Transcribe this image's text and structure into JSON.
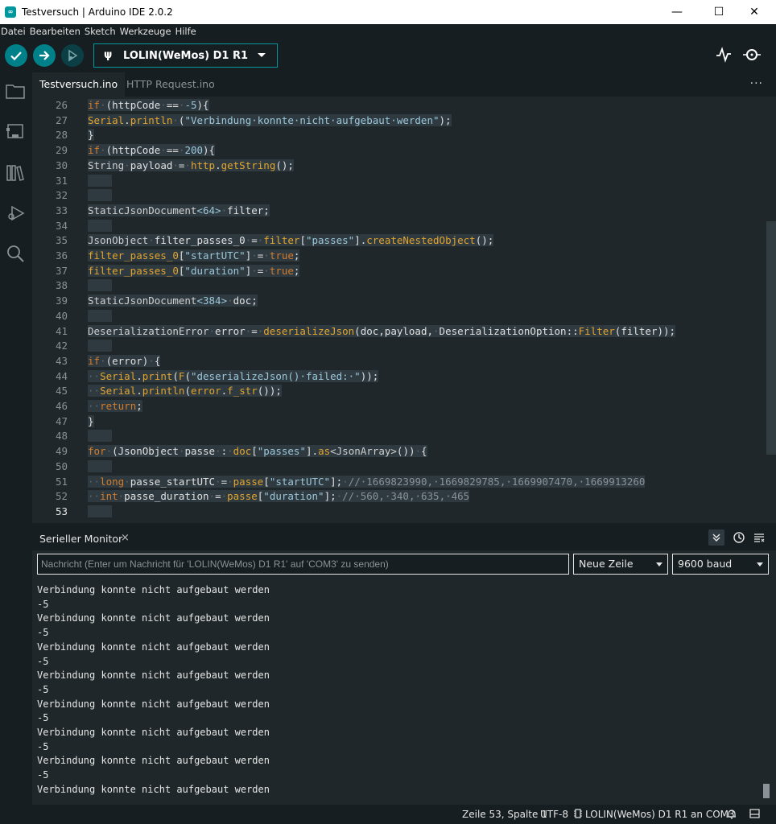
{
  "window": {
    "title": "Testversuch | Arduino IDE 2.0.2",
    "app_icon": "arduino-icon"
  },
  "menu": [
    "Datei",
    "Bearbeiten",
    "Sketch",
    "Werkzeuge",
    "Hilfe"
  ],
  "toolbar": {
    "verify_icon": "check-icon",
    "upload_icon": "arrow-right-icon",
    "debug_icon": "debug-icon",
    "board": "LOLIN(WeMos) D1 R1",
    "plotter_icon": "pulse-icon",
    "monitor_icon": "magnifier-icon"
  },
  "sidebar": [
    "folder-icon",
    "board-icon",
    "library-icon",
    "debug-icon",
    "search-icon"
  ],
  "tabs": [
    {
      "label": "Testversuch.ino",
      "active": true
    },
    {
      "label": "HTTP Request.ino",
      "active": false
    }
  ],
  "tabs_more": "···",
  "editor": {
    "current_line": 53,
    "lines": [
      {
        "n": "26",
        "segs": [
          [
            "kw",
            "if"
          ],
          [
            "ws",
            "·"
          ],
          [
            "",
            "(httpCode"
          ],
          [
            "ws",
            "·"
          ],
          [
            "",
            "=="
          ],
          [
            "ws",
            "·"
          ],
          [
            "num",
            "-5"
          ],
          [
            "",
            "){"
          ]
        ]
      },
      {
        "n": "27",
        "segs": [
          [
            "fn",
            "Serial"
          ],
          [
            "",
            "."
          ],
          [
            "fn",
            "println"
          ],
          [
            "ws",
            "·"
          ],
          [
            "",
            "("
          ],
          [
            "str",
            "\"Verbindung·konnte·nicht·aufgebaut·werden\""
          ],
          [
            "",
            ");"
          ]
        ]
      },
      {
        "n": "28",
        "segs": [
          [
            "",
            "}"
          ]
        ]
      },
      {
        "n": "29",
        "segs": [
          [
            "kw",
            "if"
          ],
          [
            "ws",
            "·"
          ],
          [
            "",
            "(httpCode"
          ],
          [
            "ws",
            "·"
          ],
          [
            "",
            "=="
          ],
          [
            "ws",
            "·"
          ],
          [
            "num",
            "200"
          ],
          [
            "",
            "){"
          ]
        ]
      },
      {
        "n": "30",
        "segs": [
          [
            "ty",
            "String"
          ],
          [
            "ws",
            "·"
          ],
          [
            "",
            "payload"
          ],
          [
            "ws",
            "·"
          ],
          [
            "",
            "="
          ],
          [
            "ws",
            "·"
          ],
          [
            "fn",
            "http"
          ],
          [
            "",
            "."
          ],
          [
            "fn",
            "getString"
          ],
          [
            "",
            "();"
          ]
        ]
      },
      {
        "n": "31",
        "segs": [
          [
            "",
            ""
          ]
        ]
      },
      {
        "n": "32",
        "segs": [
          [
            "",
            ""
          ]
        ]
      },
      {
        "n": "33",
        "segs": [
          [
            "ty",
            "StaticJsonDocument"
          ],
          [
            "num",
            "<64>"
          ],
          [
            "ws",
            "·"
          ],
          [
            "",
            "filter;"
          ]
        ]
      },
      {
        "n": "34",
        "segs": [
          [
            "",
            ""
          ]
        ]
      },
      {
        "n": "35",
        "segs": [
          [
            "ty",
            "JsonObject"
          ],
          [
            "ws",
            "·"
          ],
          [
            "",
            "filter_passes_0"
          ],
          [
            "ws",
            "·"
          ],
          [
            "",
            "="
          ],
          [
            "ws",
            "·"
          ],
          [
            "fn",
            "filter"
          ],
          [
            "",
            "["
          ],
          [
            "str",
            "\"passes\""
          ],
          [
            "",
            "]."
          ],
          [
            "fn",
            "createNestedObject"
          ],
          [
            "",
            "();"
          ]
        ]
      },
      {
        "n": "36",
        "segs": [
          [
            "fn",
            "filter_passes_0"
          ],
          [
            "",
            "["
          ],
          [
            "str",
            "\"startUTC\""
          ],
          [
            "",
            "]"
          ],
          [
            "ws",
            "·"
          ],
          [
            "",
            "="
          ],
          [
            "ws",
            "·"
          ],
          [
            "kw",
            "true"
          ],
          [
            "",
            ";"
          ]
        ]
      },
      {
        "n": "37",
        "segs": [
          [
            "fn",
            "filter_passes_0"
          ],
          [
            "",
            "["
          ],
          [
            "str",
            "\"duration\""
          ],
          [
            "",
            "]"
          ],
          [
            "ws",
            "·"
          ],
          [
            "",
            "="
          ],
          [
            "ws",
            "·"
          ],
          [
            "kw",
            "true"
          ],
          [
            "",
            ";"
          ]
        ]
      },
      {
        "n": "38",
        "segs": [
          [
            "",
            ""
          ]
        ]
      },
      {
        "n": "39",
        "segs": [
          [
            "ty",
            "StaticJsonDocument"
          ],
          [
            "num",
            "<384>"
          ],
          [
            "ws",
            "·"
          ],
          [
            "",
            "doc;"
          ]
        ]
      },
      {
        "n": "40",
        "segs": [
          [
            "",
            ""
          ]
        ]
      },
      {
        "n": "41",
        "segs": [
          [
            "ty",
            "DeserializationError"
          ],
          [
            "ws",
            "·"
          ],
          [
            "",
            "error"
          ],
          [
            "ws",
            "·"
          ],
          [
            "",
            "="
          ],
          [
            "ws",
            "·"
          ],
          [
            "fn",
            "deserializeJson"
          ],
          [
            "",
            "(doc,payload,"
          ],
          [
            "ws",
            "·"
          ],
          [
            "",
            "DeserializationOption::"
          ],
          [
            "fn",
            "Filter"
          ],
          [
            "",
            "(filter));"
          ]
        ]
      },
      {
        "n": "42",
        "segs": [
          [
            "",
            ""
          ]
        ]
      },
      {
        "n": "43",
        "segs": [
          [
            "kw",
            "if"
          ],
          [
            "ws",
            "·"
          ],
          [
            "",
            "(error)"
          ],
          [
            "ws",
            "·"
          ],
          [
            "",
            "{"
          ]
        ]
      },
      {
        "n": "44",
        "segs": [
          [
            "ws",
            "··"
          ],
          [
            "fn",
            "Serial"
          ],
          [
            "",
            "."
          ],
          [
            "fn",
            "print"
          ],
          [
            "",
            "("
          ],
          [
            "fn",
            "F"
          ],
          [
            "",
            "("
          ],
          [
            "str",
            "\"deserializeJson()·failed:·\""
          ],
          [
            "",
            "));"
          ]
        ]
      },
      {
        "n": "45",
        "segs": [
          [
            "ws",
            "··"
          ],
          [
            "fn",
            "Serial"
          ],
          [
            "",
            "."
          ],
          [
            "fn",
            "println"
          ],
          [
            "",
            "("
          ],
          [
            "fn",
            "error"
          ],
          [
            "",
            "."
          ],
          [
            "fn",
            "f_str"
          ],
          [
            "",
            "());"
          ]
        ]
      },
      {
        "n": "46",
        "segs": [
          [
            "ws",
            "··"
          ],
          [
            "kw",
            "return"
          ],
          [
            "",
            ";"
          ]
        ]
      },
      {
        "n": "47",
        "segs": [
          [
            "",
            "}"
          ]
        ]
      },
      {
        "n": "48",
        "segs": [
          [
            "",
            ""
          ]
        ]
      },
      {
        "n": "49",
        "segs": [
          [
            "kw",
            "for"
          ],
          [
            "ws",
            "·"
          ],
          [
            "",
            "(JsonObject"
          ],
          [
            "ws",
            "·"
          ],
          [
            "",
            "passe"
          ],
          [
            "ws",
            "·"
          ],
          [
            "",
            ":"
          ],
          [
            "ws",
            "·"
          ],
          [
            "fn",
            "doc"
          ],
          [
            "",
            "["
          ],
          [
            "str",
            "\"passes\""
          ],
          [
            "",
            "]."
          ],
          [
            "fn",
            "as"
          ],
          [
            "ty",
            "<JsonArray>"
          ],
          [
            "",
            "())"
          ],
          [
            "ws",
            "·"
          ],
          [
            "",
            "{"
          ]
        ]
      },
      {
        "n": "50",
        "segs": [
          [
            "",
            ""
          ]
        ]
      },
      {
        "n": "51",
        "segs": [
          [
            "ws",
            "··"
          ],
          [
            "kw",
            "long"
          ],
          [
            "ws",
            "·"
          ],
          [
            "",
            "passe_startUTC"
          ],
          [
            "ws",
            "·"
          ],
          [
            "",
            "="
          ],
          [
            "ws",
            "·"
          ],
          [
            "fn",
            "passe"
          ],
          [
            "",
            "["
          ],
          [
            "str",
            "\"startUTC\""
          ],
          [
            "",
            "];"
          ],
          [
            "ws",
            "·"
          ],
          [
            "cm",
            "//·1669823990,·1669829785,·1669907470,·1669913260"
          ]
        ]
      },
      {
        "n": "52",
        "segs": [
          [
            "ws",
            "··"
          ],
          [
            "kw",
            "int"
          ],
          [
            "ws",
            "·"
          ],
          [
            "",
            "passe_duration"
          ],
          [
            "ws",
            "·"
          ],
          [
            "",
            "="
          ],
          [
            "ws",
            "·"
          ],
          [
            "fn",
            "passe"
          ],
          [
            "",
            "["
          ],
          [
            "str",
            "\"duration\""
          ],
          [
            "",
            "];"
          ],
          [
            "ws",
            "·"
          ],
          [
            "cm",
            "//·560,·340,·635,·465"
          ]
        ]
      },
      {
        "n": "53",
        "segs": [
          [
            "",
            ""
          ]
        ]
      }
    ]
  },
  "monitor": {
    "title": "Serieller Monitor",
    "close": "×",
    "input_placeholder": "Nachricht (Enter um Nachricht für 'LOLIN(WeMos) D1 R1' auf 'COM3' zu senden)",
    "line_ending": "Neue Zeile",
    "baud": "9600 baud",
    "output": [
      "Verbindung konnte nicht aufgebaut werden",
      "-5",
      "Verbindung konnte nicht aufgebaut werden",
      "-5",
      "Verbindung konnte nicht aufgebaut werden",
      "-5",
      "Verbindung konnte nicht aufgebaut werden",
      "-5",
      "Verbindung konnte nicht aufgebaut werden",
      "-5",
      "Verbindung konnte nicht aufgebaut werden",
      "-5",
      "Verbindung konnte nicht aufgebaut werden",
      "-5",
      "Verbindung konnte nicht aufgebaut werden"
    ]
  },
  "status": {
    "position": "Zeile 53, Spalte 1",
    "encoding": "UTF-8",
    "board_port": "LOLIN(WeMos) D1 R1 an COM3"
  },
  "colors": {
    "accent": "#00979d",
    "background": "#171e21",
    "editor_bg": "#1f272a"
  }
}
